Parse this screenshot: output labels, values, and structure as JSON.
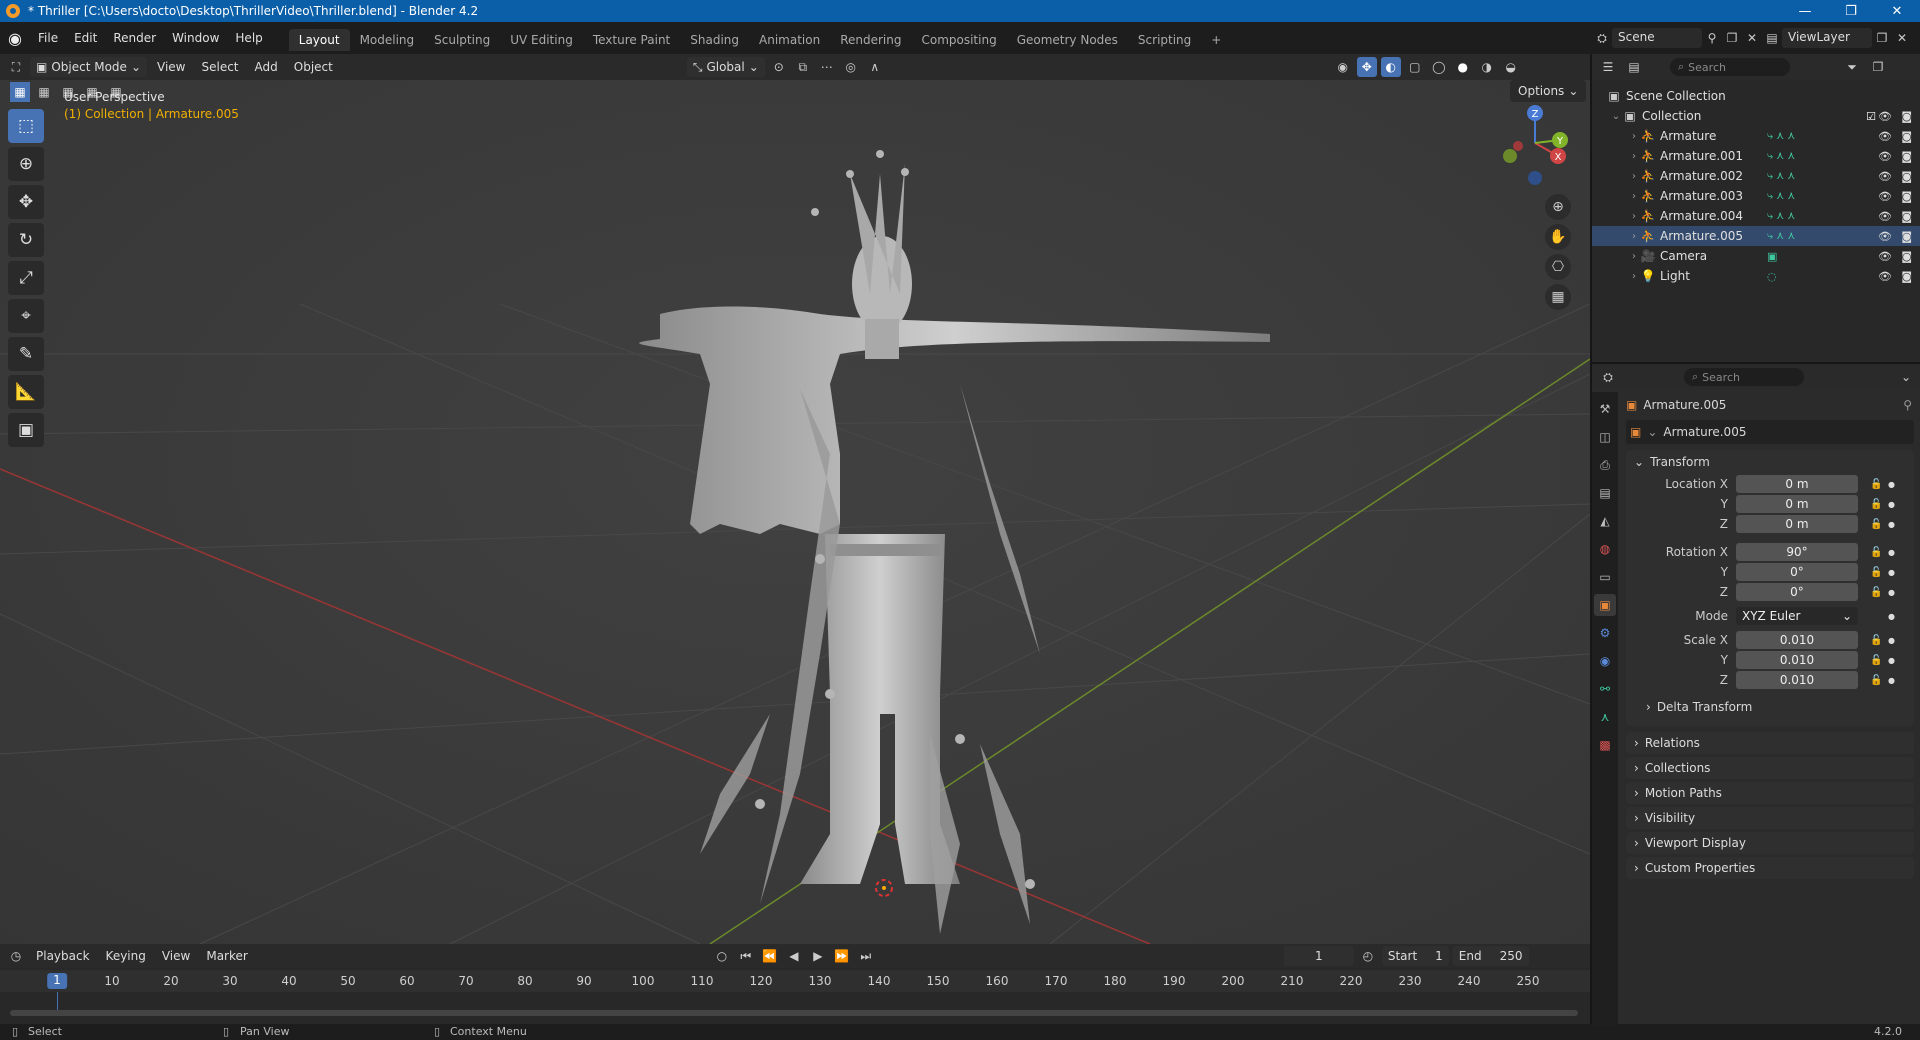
{
  "window": {
    "title": "* Thriller [C:\\Users\\docto\\Desktop\\ThrillerVideo\\Thriller.blend] - Blender 4.2",
    "min": "—",
    "max": "❐",
    "close": "✕"
  },
  "menu": [
    "File",
    "Edit",
    "Render",
    "Window",
    "Help"
  ],
  "workspaces": [
    "Layout",
    "Modeling",
    "Sculpting",
    "UV Editing",
    "Texture Paint",
    "Shading",
    "Animation",
    "Rendering",
    "Compositing",
    "Geometry Nodes",
    "Scripting"
  ],
  "scene": {
    "name": "Scene",
    "view_layer": "ViewLayer"
  },
  "viewport": {
    "mode": "Object Mode",
    "menus": [
      "View",
      "Select",
      "Add",
      "Object"
    ],
    "orientation": "Global",
    "options": "Options",
    "perspective": "User Perspective",
    "collection_info": "(1) Collection | Armature.005"
  },
  "gizmo": {
    "x": "X",
    "y": "Y",
    "z": "Z"
  },
  "outliner": {
    "search": "Search",
    "root": "Scene Collection",
    "collection": "Collection",
    "items": [
      {
        "name": "Armature",
        "type": "armature"
      },
      {
        "name": "Armature.001",
        "type": "armature"
      },
      {
        "name": "Armature.002",
        "type": "armature"
      },
      {
        "name": "Armature.003",
        "type": "armature"
      },
      {
        "name": "Armature.004",
        "type": "armature"
      },
      {
        "name": "Armature.005",
        "type": "armature",
        "selected": true
      },
      {
        "name": "Camera",
        "type": "camera"
      },
      {
        "name": "Light",
        "type": "light"
      }
    ]
  },
  "properties": {
    "search": "Search",
    "object_name": "Armature.005",
    "datablock": "Armature.005",
    "transform_title": "Transform",
    "location": {
      "label": "Location X",
      "x": "0 m",
      "y": "0 m",
      "z": "0 m"
    },
    "rotation": {
      "label": "Rotation X",
      "x": "90°",
      "y": "0°",
      "z": "0°"
    },
    "mode_label": "Mode",
    "mode": "XYZ Euler",
    "scale": {
      "label": "Scale X",
      "x": "0.010",
      "y": "0.010",
      "z": "0.010"
    },
    "axis_y": "Y",
    "axis_z": "Z",
    "delta": "Delta Transform",
    "panels": [
      "Relations",
      "Collections",
      "Motion Paths",
      "Visibility",
      "Viewport Display",
      "Custom Properties"
    ]
  },
  "timeline": {
    "menus": [
      "Playback",
      "Keying",
      "View",
      "Marker"
    ],
    "current_frame": "1",
    "start_label": "Start",
    "start": "1",
    "end_label": "End",
    "end": "250",
    "ticks": [
      "10",
      "20",
      "30",
      "40",
      "50",
      "60",
      "70",
      "80",
      "90",
      "100",
      "110",
      "120",
      "130",
      "140",
      "150",
      "160",
      "170",
      "180",
      "190",
      "200",
      "210",
      "220",
      "230",
      "240",
      "250"
    ]
  },
  "status": {
    "select": "Select",
    "pan": "Pan View",
    "context": "Context Menu",
    "version": "4.2.0"
  }
}
